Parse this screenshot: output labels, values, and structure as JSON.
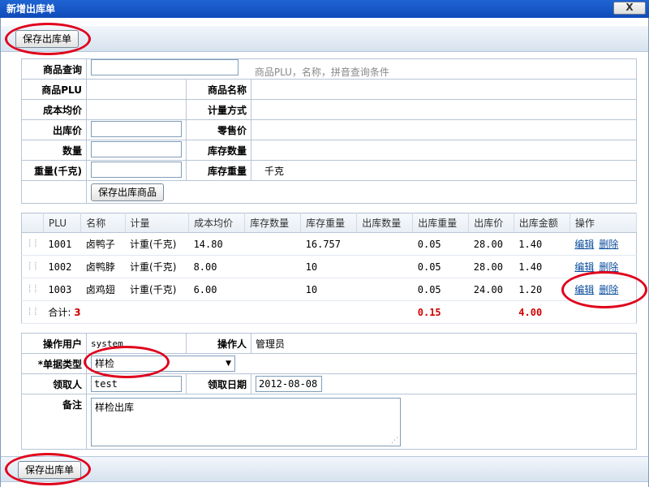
{
  "window": {
    "title": "新增出库单",
    "close_glyph": "X"
  },
  "toolbar": {
    "save_label": "保存出库单"
  },
  "query_form": {
    "search_label": "商品查询",
    "search_value": "",
    "search_hint": "商品PLU，名称，拼音查询条件",
    "plu_label": "商品PLU",
    "name_label": "商品名称",
    "cost_label": "成本均价",
    "measure_label": "计量方式",
    "out_price_label": "出库价",
    "retail_label": "零售价",
    "qty_label": "数量",
    "stock_qty_label": "库存数量",
    "weight_label": "重量(千克)",
    "stock_weight_label": "库存重量",
    "stock_weight_unit": "千克",
    "save_item_label": "保存出库商品"
  },
  "grid": {
    "headers": [
      "PLU",
      "名称",
      "计量",
      "成本均价",
      "库存数量",
      "库存重量",
      "出库数量",
      "出库重量",
      "出库价",
      "出库金额",
      "操作"
    ],
    "rows": [
      {
        "plu": "1001",
        "name": "卤鸭子",
        "measure": "计重(千克)",
        "cost": "14.80",
        "stock_qty": "",
        "stock_weight": "16.757",
        "out_qty": "",
        "out_weight": "0.05",
        "out_price": "28.00",
        "amount": "1.40"
      },
      {
        "plu": "1002",
        "name": "卤鸭脖",
        "measure": "计重(千克)",
        "cost": "8.00",
        "stock_qty": "",
        "stock_weight": "10",
        "out_qty": "",
        "out_weight": "0.05",
        "out_price": "28.00",
        "amount": "1.40"
      },
      {
        "plu": "1003",
        "name": "卤鸡翅",
        "measure": "计重(千克)",
        "cost": "6.00",
        "stock_qty": "",
        "stock_weight": "10",
        "out_qty": "",
        "out_weight": "0.05",
        "out_price": "24.00",
        "amount": "1.20"
      }
    ],
    "edit_label": "编辑",
    "delete_label": "删除",
    "total_label": "合计:",
    "total_count": "3",
    "total_weight": "0.15",
    "total_amount": "4.00"
  },
  "meta_form": {
    "op_user_label": "操作用户",
    "op_user_value": "system",
    "operator_label": "操作人",
    "operator_value": "管理员",
    "type_label": "*单据类型",
    "type_value": "样检",
    "receiver_label": "领取人",
    "receiver_value": "test",
    "date_label": "领取日期",
    "date_value": "2012-08-08",
    "note_label": "备注",
    "note_value": "样检出库"
  },
  "colors": {
    "highlight_ring": "#e0001b",
    "title_bar": "#1f63d3",
    "total_red": "#d00000"
  }
}
